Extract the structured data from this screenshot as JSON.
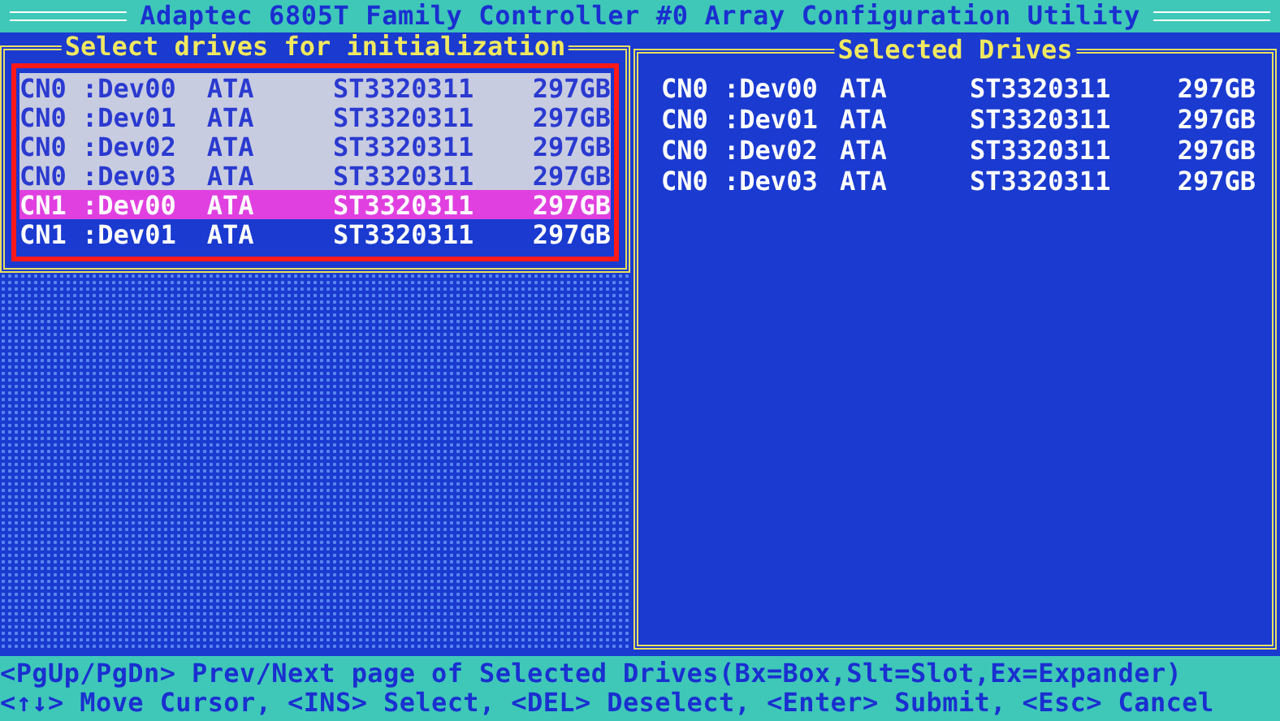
{
  "title": "Adaptec 6805T Family Controller #0 Array Configuration Utility",
  "select_panel": {
    "title": "Select drives for initialization",
    "drives": [
      {
        "device": "CN0 :Dev00",
        "type": "ATA",
        "model": "ST3320311",
        "size": "297GB",
        "selected": true,
        "cursor": false
      },
      {
        "device": "CN0 :Dev01",
        "type": "ATA",
        "model": "ST3320311",
        "size": "297GB",
        "selected": true,
        "cursor": false
      },
      {
        "device": "CN0 :Dev02",
        "type": "ATA",
        "model": "ST3320311",
        "size": "297GB",
        "selected": true,
        "cursor": false
      },
      {
        "device": "CN0 :Dev03",
        "type": "ATA",
        "model": "ST3320311",
        "size": "297GB",
        "selected": true,
        "cursor": false
      },
      {
        "device": "CN1 :Dev00",
        "type": "ATA",
        "model": "ST3320311",
        "size": "297GB",
        "selected": false,
        "cursor": true
      },
      {
        "device": "CN1 :Dev01",
        "type": "ATA",
        "model": "ST3320311",
        "size": "297GB",
        "selected": false,
        "cursor": false
      }
    ]
  },
  "selected_panel": {
    "title": "Selected Drives",
    "drives": [
      {
        "device": "CN0 :Dev00",
        "type": "ATA",
        "model": "ST3320311",
        "size": "297GB"
      },
      {
        "device": "CN0 :Dev01",
        "type": "ATA",
        "model": "ST3320311",
        "size": "297GB"
      },
      {
        "device": "CN0 :Dev02",
        "type": "ATA",
        "model": "ST3320311",
        "size": "297GB"
      },
      {
        "device": "CN0 :Dev03",
        "type": "ATA",
        "model": "ST3320311",
        "size": "297GB"
      }
    ]
  },
  "help_lines": [
    "<PgUp/PgDn> Prev/Next page of Selected Drives(Bx=Box,Slt=Slot,Ex=Expander)",
    "<↑↓> Move Cursor, <INS> Select, <DEL> Deselect, <Enter> Submit, <Esc> Cancel"
  ]
}
